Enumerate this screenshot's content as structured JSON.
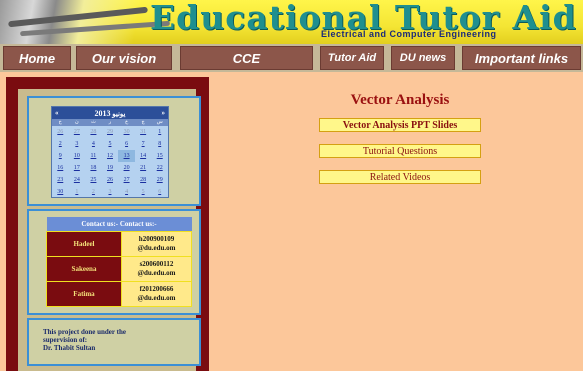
{
  "header": {
    "title": "Educational Tutor Aid",
    "subtitle": "Electrical and Computer Engineering"
  },
  "nav": {
    "items": [
      {
        "label": "Home"
      },
      {
        "label": "Our vision"
      },
      {
        "label": "CCE"
      },
      {
        "label": "Tutor Aid"
      },
      {
        "label": "DU news"
      },
      {
        "label": "Important links"
      }
    ]
  },
  "calendar": {
    "year_label": "2013",
    "month_label": "يونيو",
    "prev": "«",
    "next": "»",
    "dow": [
      "ح",
      "ن",
      "ث",
      "ر",
      "خ",
      "ج",
      "س"
    ],
    "days": [
      [
        "26",
        "27",
        "28",
        "29",
        "30",
        "31",
        "1"
      ],
      [
        "2",
        "3",
        "4",
        "5",
        "6",
        "7",
        "8"
      ],
      [
        "9",
        "10",
        "11",
        "12",
        "13",
        "14",
        "15"
      ],
      [
        "16",
        "17",
        "18",
        "19",
        "20",
        "21",
        "22"
      ],
      [
        "23",
        "24",
        "25",
        "26",
        "27",
        "28",
        "29"
      ],
      [
        "30",
        "1",
        "2",
        "3",
        "4",
        "5",
        "6"
      ]
    ],
    "today": "13"
  },
  "contacts": {
    "header": "Contact us:- Contact us:-",
    "rows": [
      {
        "name": "Hadeel",
        "email_line1": "h200900109",
        "email_line2": "@du.edu.om"
      },
      {
        "name": "Sakeena",
        "email_line1": "s200600112",
        "email_line2": "@du.edu.om"
      },
      {
        "name": "Fatima",
        "email_line1": "f201200666",
        "email_line2": "@du.edu.om"
      }
    ]
  },
  "project": {
    "line1": "This project done under the",
    "line2": "supervision of:",
    "line3": "Dr. Thabit Sultan"
  },
  "main": {
    "title": "Vector Analysis",
    "links": [
      {
        "label": "Vector Analysis PPT Slides"
      },
      {
        "label": "Tutorial Questions"
      },
      {
        "label": "Related Videos"
      }
    ]
  },
  "colors": {
    "page_bg": "#fcc79a",
    "header_yellow": "#f4e534",
    "nav_button": "#8c564a",
    "sidebar_maroon": "#7a0c10",
    "title_red": "#9a1010",
    "link_yellow": "#fff78a"
  }
}
